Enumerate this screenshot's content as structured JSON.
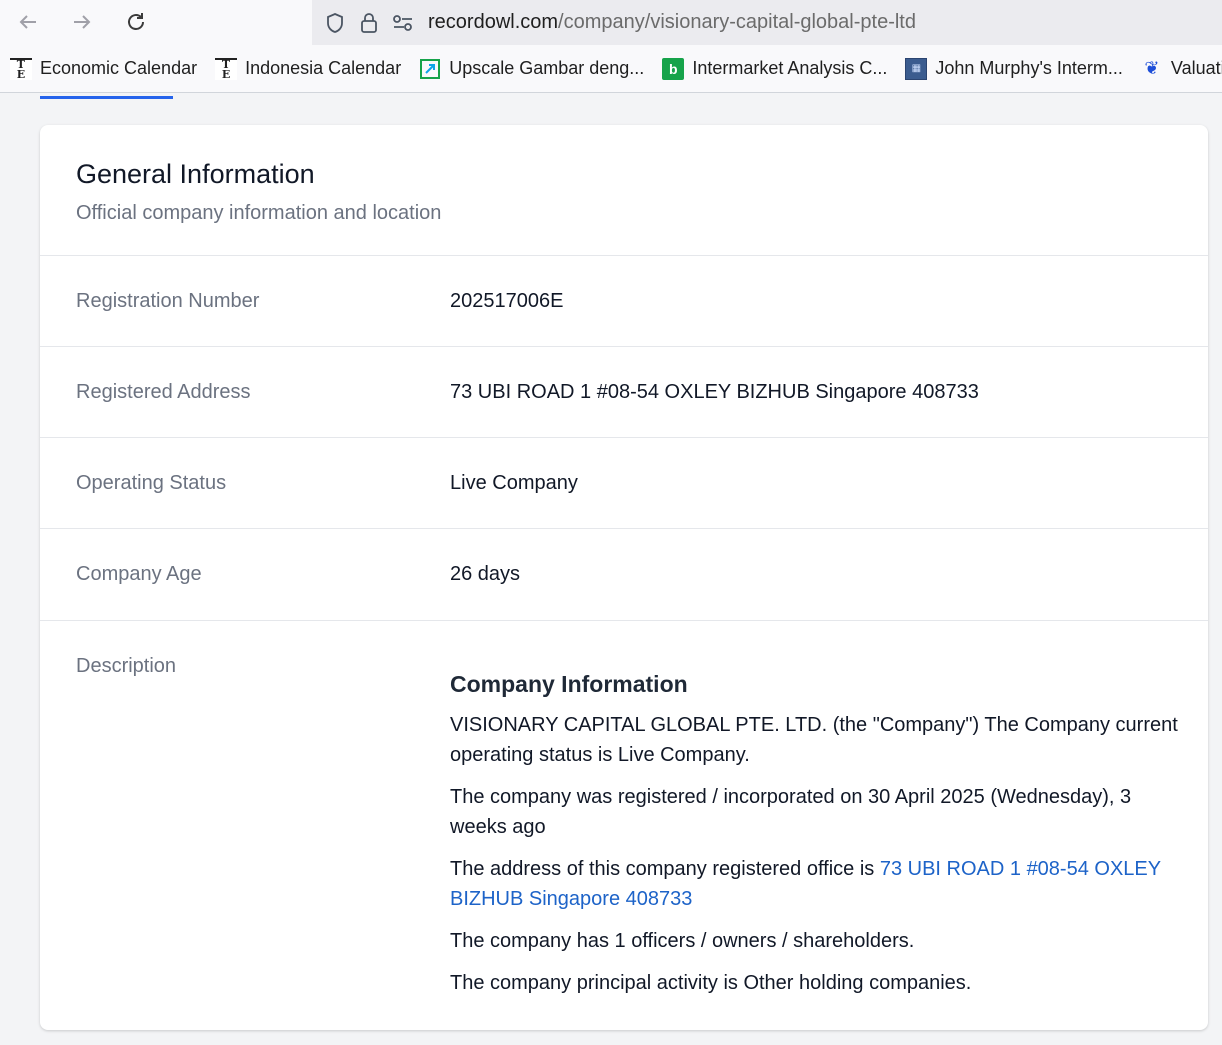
{
  "browser": {
    "url_host": "recordowl.com",
    "url_path": "/company/visionary-capital-global-pte-ltd",
    "bookmarks": [
      {
        "label": "Economic Calendar",
        "icon": "te-icon"
      },
      {
        "label": "Indonesia Calendar",
        "icon": "te-icon"
      },
      {
        "label": "Upscale Gambar deng...",
        "icon": "upscale-icon"
      },
      {
        "label": "Intermarket Analysis C...",
        "icon": "b-icon"
      },
      {
        "label": "John Murphy's Interm...",
        "icon": "jm-icon"
      },
      {
        "label": "Valuatio",
        "icon": "valuation-icon"
      }
    ]
  },
  "card": {
    "title": "General Information",
    "subtitle": "Official company information and location",
    "rows": [
      {
        "label": "Registration Number",
        "value": "202517006E"
      },
      {
        "label": "Registered Address",
        "value": "73 UBI ROAD 1 #08-54 OXLEY BIZHUB Singapore 408733"
      },
      {
        "label": "Operating Status",
        "value": "Live Company"
      },
      {
        "label": "Company Age",
        "value": "26 days"
      }
    ],
    "description": {
      "label": "Description",
      "title": "Company Information",
      "p1": "VISIONARY CAPITAL GLOBAL PTE. LTD. (the \"Company\") The Company current operating status is Live Company.",
      "p2": "The company was registered / incorporated on 30 April 2025 (Wednesday), 3 weeks ago",
      "p3_prefix": "The address of this company registered office is ",
      "p3_link": "73 UBI ROAD 1 #08-54 OXLEY BIZHUB Singapore 408733",
      "p4": "The company has 1 officers / owners / shareholders.",
      "p5": "The company principal activity is Other holding companies."
    }
  },
  "colors": {
    "link": "#1d63c8",
    "accent": "#2563eb"
  }
}
